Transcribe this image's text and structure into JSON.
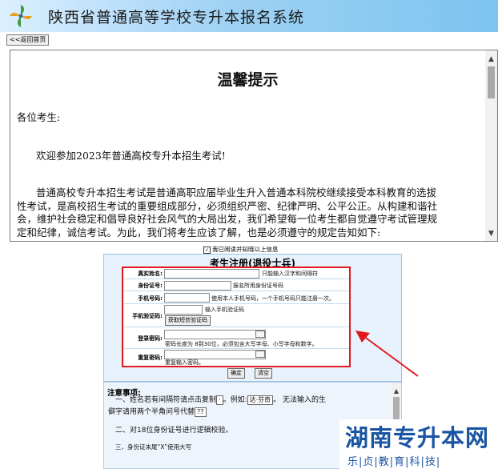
{
  "header": {
    "title": "陕西省普通高等学校专升本报名系统"
  },
  "nav": {
    "back_label": "<<返回首页"
  },
  "notice": {
    "title": "温馨提示",
    "greeting": "各位考生:",
    "welcome": "欢迎参加2023年普通高校专升本招生考试!",
    "paragraph": "普通高校专升本招生考试是普通高职应届毕业生升入普通本科院校继续接受本科教育的选拔性考试，是高校招生考试的重要组成部分，必须组织严密、纪律严明、公平公正。从构建和谐社会，维护社会稳定和倡导良好社会风气的大局出发，我们希望每一位考生都自觉遵守考试管理规定和纪律，诚信考试。为此，我们将考生应该了解，也是必须遵守的规定告知如下:"
  },
  "agree": {
    "checked": true,
    "label": "我已阅读并知晓以上信息"
  },
  "form": {
    "title": "考生注册(退役士兵)",
    "fields": [
      {
        "label": "真实姓名:",
        "hint": "只能输入汉字和间隔符"
      },
      {
        "label": "身份证号:",
        "hint": "报名所用身份证号码"
      },
      {
        "label": "手机号码:",
        "hint": "使用本人手机号码，一个手机号码只能注册一次。"
      },
      {
        "label": "手机验证码:",
        "hint": "输入手机验证码",
        "button": "获取短信验证码"
      },
      {
        "label": "登录密码:",
        "hint": "密码长度为 8到30位，必须包含大写字母、小写字母和数字。"
      },
      {
        "label": "重复密码:",
        "hint": "重复输入密码。"
      }
    ],
    "confirm_label": "确定",
    "clear_label": "清空"
  },
  "notes": {
    "title": "注意事项:",
    "line1_a": "一、姓名若有间隔符请点击复制",
    "line1_dot": "·",
    "line1_b": "。例如:",
    "line1_example": "达·芬奇",
    "line1_c": "。 无法输入的生",
    "line2": "僻字请用两个半角问号代替",
    "line2_chip": "??",
    "line3": "二、对18位身份证号进行逻辑校验。",
    "line4": "三、身份证末尾“X”使用大写"
  },
  "watermark": {
    "main": "湖南专升本网",
    "sub": "乐|贞|教|育|科|技|"
  },
  "colors": {
    "highlight": "#e0191f",
    "form_bg": "#e8f2fd",
    "watermark": "#1a55a3"
  }
}
